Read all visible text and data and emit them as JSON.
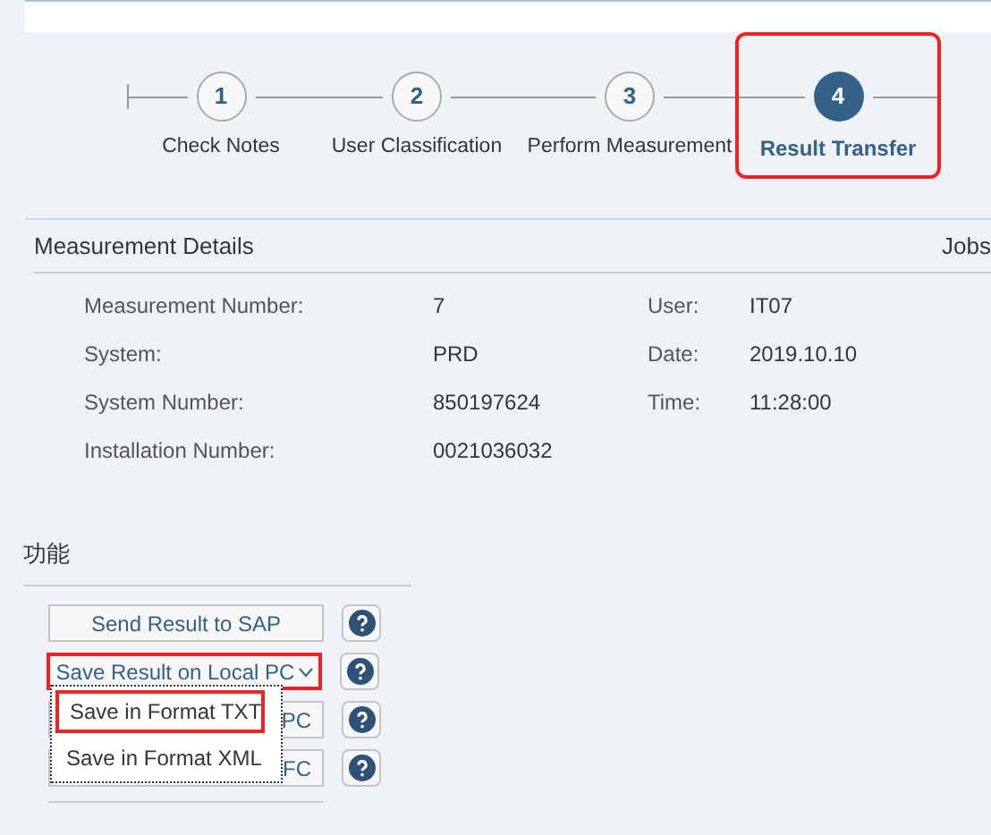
{
  "steps": [
    {
      "number": "1",
      "label": "Check Notes",
      "selected": false,
      "highlighted": false
    },
    {
      "number": "2",
      "label": "User Classification",
      "selected": false,
      "highlighted": false
    },
    {
      "number": "3",
      "label": "Perform Measurement",
      "selected": false,
      "highlighted": false
    },
    {
      "number": "4",
      "label": "Result Transfer",
      "selected": true,
      "highlighted": true
    }
  ],
  "details": {
    "title": "Measurement Details",
    "side_title": "Jobs",
    "fields": [
      {
        "label": "Measurement Number:",
        "value": "7"
      },
      {
        "label": "System:",
        "value": "PRD"
      },
      {
        "label": "System Number:",
        "value": "850197624"
      },
      {
        "label": "Installation Number:",
        "value": "0021036032"
      }
    ],
    "side_fields": [
      {
        "label": "User:",
        "value": "IT07"
      },
      {
        "label": "Date:",
        "value": "2019.10.10"
      },
      {
        "label": "Time:",
        "value": "11:28:00"
      }
    ]
  },
  "functions": {
    "title": "功能",
    "buttons": [
      {
        "kind": "button",
        "label": "Send Result to SAP",
        "highlighted": false
      },
      {
        "kind": "dropdown",
        "label": "Save Result on Local PC",
        "highlighted": true,
        "expanded": true
      },
      {
        "kind": "button",
        "label": "PC",
        "highlighted": false
      },
      {
        "kind": "button",
        "label": "FC",
        "highlighted": false
      }
    ],
    "menu": [
      {
        "label": "Save in Format TXT",
        "highlighted": true
      },
      {
        "label": "Save in Format XML",
        "highlighted": false
      }
    ]
  }
}
